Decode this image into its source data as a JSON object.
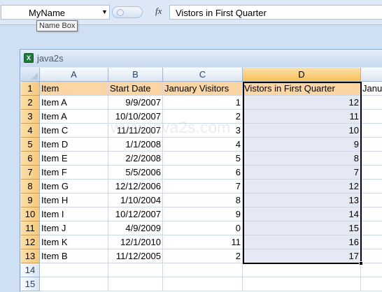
{
  "name_box": {
    "value": "MyName",
    "tooltip": "Name Box"
  },
  "formula_bar": {
    "fx_label": "fx",
    "value": "Vistors in First Quarter"
  },
  "workbook": {
    "title": "java2s"
  },
  "watermark": "www.java2s.com",
  "columns": [
    "A",
    "B",
    "C",
    "D"
  ],
  "rows": [
    {
      "num": "1",
      "a": "Item",
      "b": "Start Date",
      "c": "January Visitors",
      "d": "Vistors in First Quarter",
      "e": "Janu"
    },
    {
      "num": "2",
      "a": "Item A",
      "b": "9/9/2007",
      "c": "1",
      "d": "12"
    },
    {
      "num": "3",
      "a": "Item A",
      "b": "10/10/2007",
      "c": "2",
      "d": "11"
    },
    {
      "num": "4",
      "a": "Item C",
      "b": "11/11/2007",
      "c": "3",
      "d": "10"
    },
    {
      "num": "5",
      "a": "Item D",
      "b": "1/1/2008",
      "c": "4",
      "d": "9"
    },
    {
      "num": "6",
      "a": "Item E",
      "b": "2/2/2008",
      "c": "5",
      "d": "8"
    },
    {
      "num": "7",
      "a": "Item F",
      "b": "5/5/2006",
      "c": "6",
      "d": "7"
    },
    {
      "num": "8",
      "a": "Item G",
      "b": "12/12/2006",
      "c": "7",
      "d": "12"
    },
    {
      "num": "9",
      "a": "Item H",
      "b": "1/10/2004",
      "c": "8",
      "d": "13"
    },
    {
      "num": "10",
      "a": "Item I",
      "b": "10/12/2007",
      "c": "9",
      "d": "14"
    },
    {
      "num": "11",
      "a": "Item J",
      "b": "4/9/2009",
      "c": "0",
      "d": "15"
    },
    {
      "num": "12",
      "a": "Item K",
      "b": "12/1/2010",
      "c": "11",
      "d": "16"
    },
    {
      "num": "13",
      "a": "Item B",
      "b": "11/12/2005",
      "c": "2",
      "d": "17"
    },
    {
      "num": "14",
      "a": "",
      "b": "",
      "c": "",
      "d": ""
    },
    {
      "num": "15",
      "a": "",
      "b": "",
      "c": "",
      "d": ""
    }
  ],
  "colors": {
    "selected_header": "#f7c05a",
    "header_row": "#fcd5a4",
    "selected_column": "#e4e9f3"
  }
}
